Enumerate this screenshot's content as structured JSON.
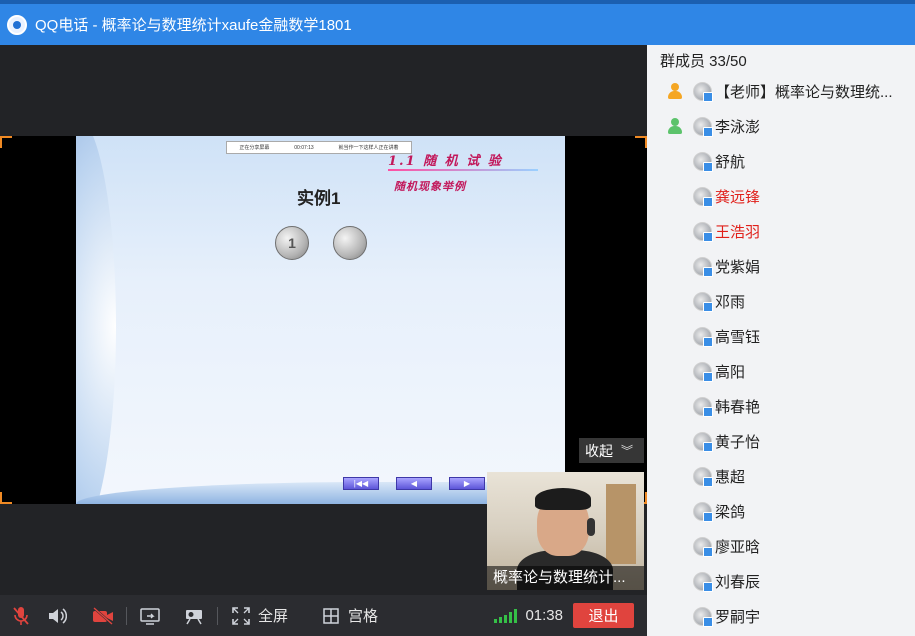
{
  "window": {
    "title": "QQ电话 - 概率论与数理统计xaufe金融数学1801"
  },
  "slide": {
    "header_left": "正在分享屏幕",
    "header_mid": "00:07:13",
    "header_right": "就当作一下这样人正在讲着",
    "heading": "1.1  随 机 试 验",
    "subheading": "随机现象举例",
    "example": "实例1",
    "coin1": "1",
    "coin2": "",
    "nav_first": "|◀◀",
    "nav_prev": "◀",
    "nav_next": "▶"
  },
  "collapse": {
    "label": "收起"
  },
  "video": {
    "name": "概率论与数理统计..."
  },
  "toolbar": {
    "fullscreen_label": "全屏",
    "grid_label": "宫格",
    "timer": "01:38",
    "exit_label": "退出",
    "accent": "#e0443e"
  },
  "sidebar": {
    "member_count": "群成员 33/50",
    "members": [
      {
        "name": "【老师】概率论与数理统...",
        "role": "teacher",
        "color": "#222"
      },
      {
        "name": "李泳澎",
        "role": "member",
        "color": "#222"
      },
      {
        "name": "舒航",
        "role": "",
        "color": "#222"
      },
      {
        "name": "龚远锋",
        "role": "",
        "color": "#e0201a"
      },
      {
        "name": "王浩羽",
        "role": "",
        "color": "#e0201a"
      },
      {
        "name": "党紫娟",
        "role": "",
        "color": "#222"
      },
      {
        "name": "邓雨",
        "role": "",
        "color": "#222"
      },
      {
        "name": "高雪钰",
        "role": "",
        "color": "#222"
      },
      {
        "name": "高阳",
        "role": "",
        "color": "#222"
      },
      {
        "name": "韩春艳",
        "role": "",
        "color": "#222"
      },
      {
        "name": "黄子怡",
        "role": "",
        "color": "#222"
      },
      {
        "name": "惠超",
        "role": "",
        "color": "#222"
      },
      {
        "name": "梁鸽",
        "role": "",
        "color": "#222"
      },
      {
        "name": "廖亚晗",
        "role": "",
        "color": "#222"
      },
      {
        "name": "刘春辰",
        "role": "",
        "color": "#222"
      },
      {
        "name": "罗嗣宇",
        "role": "",
        "color": "#222"
      }
    ]
  }
}
